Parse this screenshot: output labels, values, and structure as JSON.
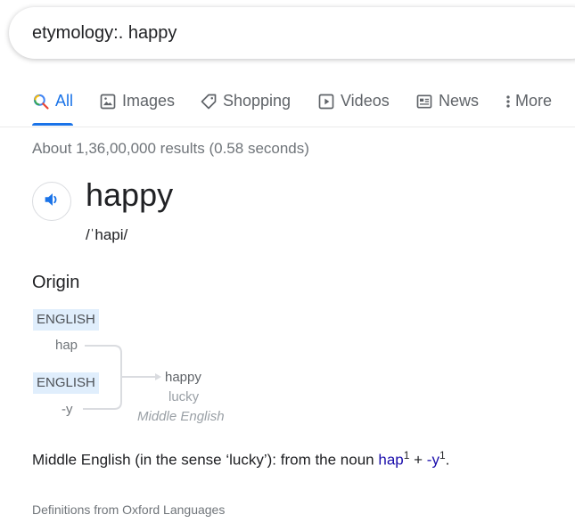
{
  "search": {
    "query": "etymology:. happy"
  },
  "tabs": [
    {
      "label": "All",
      "icon": "search-icon",
      "active": true
    },
    {
      "label": "Images",
      "icon": "image-icon"
    },
    {
      "label": "Shopping",
      "icon": "tag-icon"
    },
    {
      "label": "Videos",
      "icon": "play-icon"
    },
    {
      "label": "News",
      "icon": "news-icon"
    },
    {
      "label": "More",
      "icon": "more-vert-icon"
    }
  ],
  "result_stats": "About 1,36,00,000 results (0.58 seconds)",
  "dictionary": {
    "word": "happy",
    "phonetic": "/ˈhapi/",
    "origin_heading": "Origin",
    "etymology": {
      "source1_lang": "ENGLISH",
      "source1_word": "hap",
      "source2_lang": "ENGLISH",
      "source2_word": "-y",
      "result_word": "happy",
      "result_meaning": "lucky",
      "result_lang": "Middle English"
    },
    "definition": {
      "prefix": "Middle English (in the sense ‘lucky’): from the noun ",
      "link1": "hap",
      "sup1": "1",
      "plus": " + ",
      "link2": "-y",
      "sup2": "1",
      "suffix": "."
    },
    "source": "Definitions from Oxford Languages"
  },
  "colors": {
    "accent": "#1a73e8",
    "link": "#1a0dab",
    "tag_bg": "#e0eefc"
  }
}
